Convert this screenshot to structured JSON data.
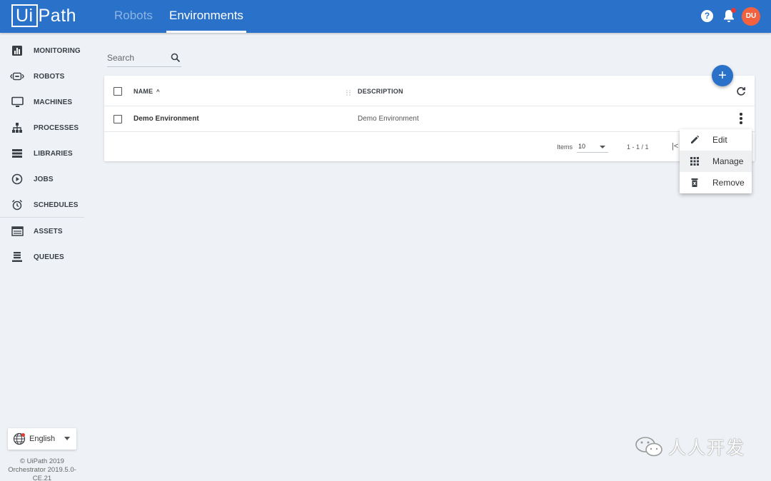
{
  "header": {
    "logo_box": "Ui",
    "logo_rest": "Path",
    "tabs": [
      {
        "label": "Robots",
        "active": false
      },
      {
        "label": "Environments",
        "active": true
      }
    ],
    "help_icon": "question-circle-icon",
    "notification_icon": "bell-icon",
    "avatar_initials": "DU",
    "accent_color": "#2a72c9",
    "avatar_color": "#f4613e"
  },
  "sidebar": {
    "items": [
      {
        "label": "MONITORING",
        "icon": "bar-chart-icon"
      },
      {
        "label": "ROBOTS",
        "icon": "robot-icon"
      },
      {
        "label": "MACHINES",
        "icon": "monitor-icon"
      },
      {
        "label": "PROCESSES",
        "icon": "sitemap-icon"
      },
      {
        "label": "LIBRARIES",
        "icon": "list-icon"
      },
      {
        "label": "JOBS",
        "icon": "play-circle-icon"
      },
      {
        "label": "SCHEDULES",
        "icon": "alarm-clock-icon"
      },
      {
        "label": "ASSETS",
        "icon": "table-icon"
      },
      {
        "label": "QUEUES",
        "icon": "queue-icon"
      }
    ],
    "language": "English",
    "copyright": "© UiPath 2019",
    "version": "Orchestrator 2019.5.0-CE.21"
  },
  "search": {
    "placeholder": "Search"
  },
  "table": {
    "columns": [
      {
        "label": "NAME",
        "sorted": "asc"
      },
      {
        "label": "DESCRIPTION"
      }
    ],
    "rows": [
      {
        "name": "Demo Environment",
        "description": "Demo Environment"
      }
    ],
    "sort_indicator": "^",
    "pagination": {
      "items_label": "Items",
      "page_size": "10",
      "range": "1 - 1 / 1",
      "first_page_glyph": "|<"
    }
  },
  "add_button": {
    "label": "+"
  },
  "context_menu": {
    "items": [
      {
        "label": "Edit",
        "icon": "pencil-icon"
      },
      {
        "label": "Manage",
        "icon": "grid-icon",
        "highlighted": true
      },
      {
        "label": "Remove",
        "icon": "trash-icon"
      }
    ]
  },
  "watermark": {
    "text": "人人开发"
  }
}
